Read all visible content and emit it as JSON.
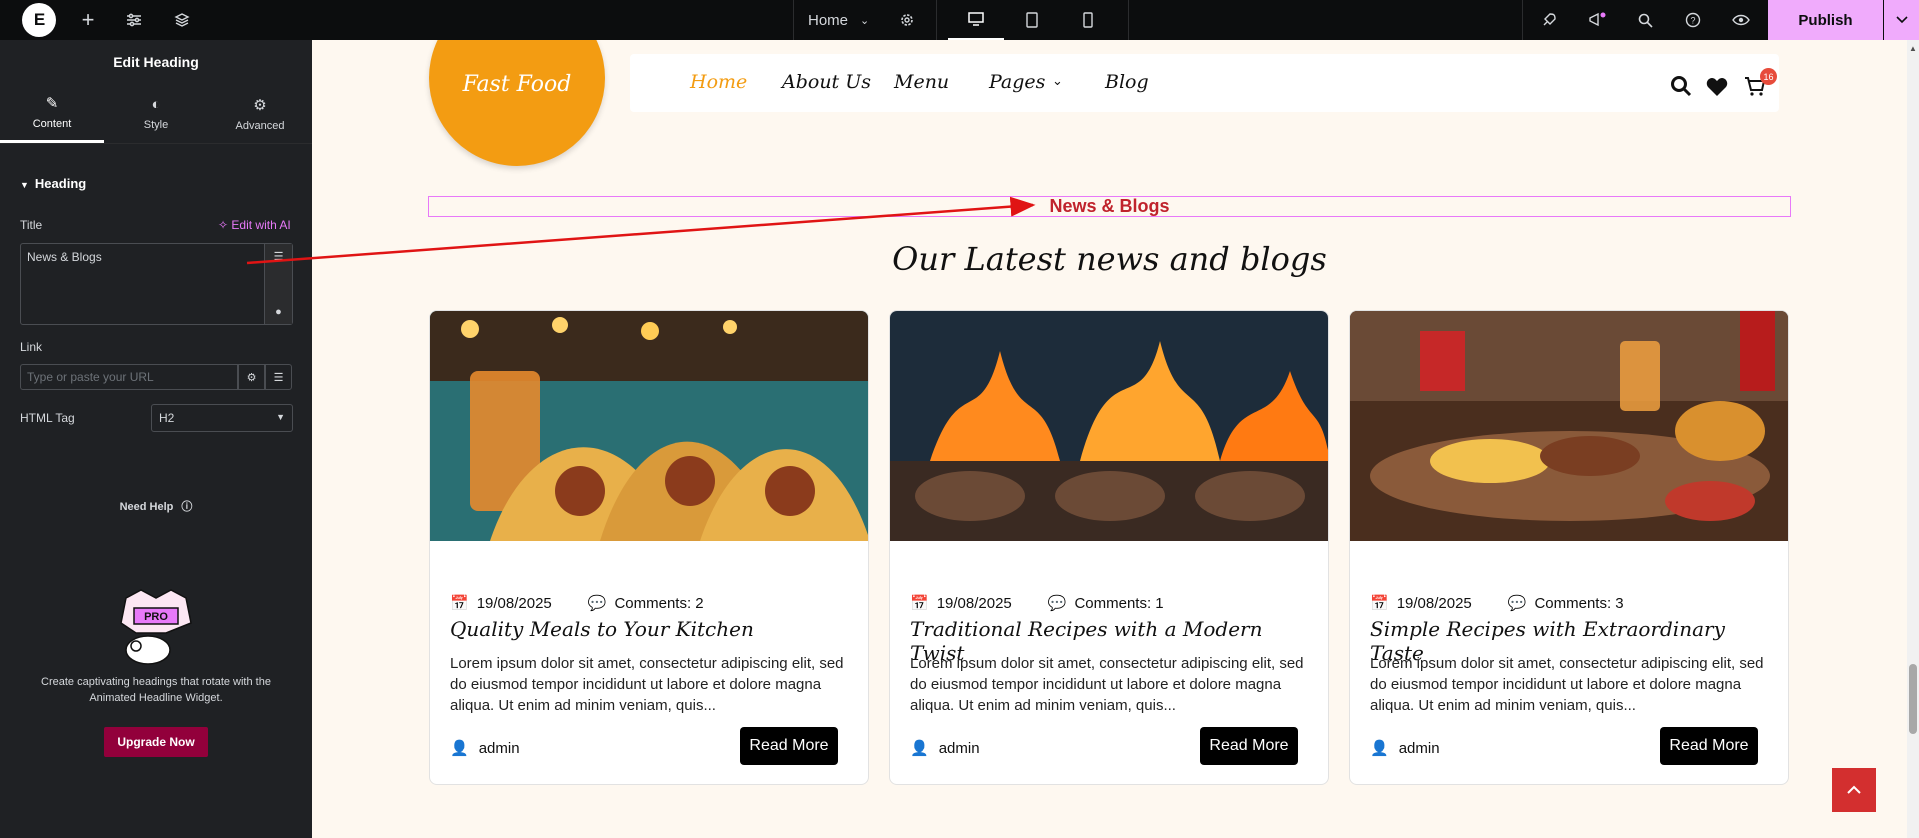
{
  "topbar": {
    "page_selector": "Home",
    "publish_label": "Publish"
  },
  "panel": {
    "title": "Edit Heading",
    "tabs": [
      {
        "label": "Content",
        "icon": "pencil-icon"
      },
      {
        "label": "Style",
        "icon": "half-circle-icon"
      },
      {
        "label": "Advanced",
        "icon": "gear-icon"
      }
    ],
    "section": "Heading",
    "title_label": "Title",
    "edit_with_ai": "Edit with AI",
    "title_value": "News & Blogs",
    "link_label": "Link",
    "link_placeholder": "Type or paste your URL",
    "html_tag_label": "HTML Tag",
    "html_tag_value": "H2",
    "need_help": "Need Help",
    "promo_text": "Create captivating headings that rotate with the Animated Headline Widget.",
    "upgrade_label": "Upgrade Now",
    "promo_badge": "PRO"
  },
  "site": {
    "logo": "Fast Food",
    "nav": [
      "Home",
      "About Us",
      "Menu",
      "Pages",
      "Blog"
    ],
    "cart_count": "16",
    "eyebrow": "News & Blogs",
    "section_title": "Our Latest news and blogs",
    "cards": [
      {
        "date": "19/08/2025",
        "comments": "Comments: 2",
        "title": "Quality Meals to Your Kitchen",
        "text": "Lorem ipsum dolor sit amet, consectetur adipiscing elit, sed do eiusmod tempor incididunt ut labore et dolore magna aliqua. Ut enim ad minim veniam, quis...",
        "author": "admin",
        "button": "Read More"
      },
      {
        "date": "19/08/2025",
        "comments": "Comments: 1",
        "title": "Traditional Recipes with a Modern Twist",
        "text": "Lorem ipsum dolor sit amet, consectetur adipiscing elit, sed do eiusmod tempor incididunt ut labore et dolore magna aliqua. Ut enim ad minim veniam, quis...",
        "author": "admin",
        "button": "Read More"
      },
      {
        "date": "19/08/2025",
        "comments": "Comments: 3",
        "title": "Simple Recipes with Extraordinary Taste",
        "text": "Lorem ipsum dolor sit amet, consectetur adipiscing elit, sed do eiusmod tempor incididunt ut labore et dolore magna aliqua. Ut enim ad minim veniam, quis...",
        "author": "admin",
        "button": "Read More"
      }
    ]
  },
  "colors": {
    "accent_pink": "#f0abfc",
    "brand_orange": "#f39c12",
    "eyebrow_red": "#c0232c",
    "upgrade": "#92003b"
  }
}
